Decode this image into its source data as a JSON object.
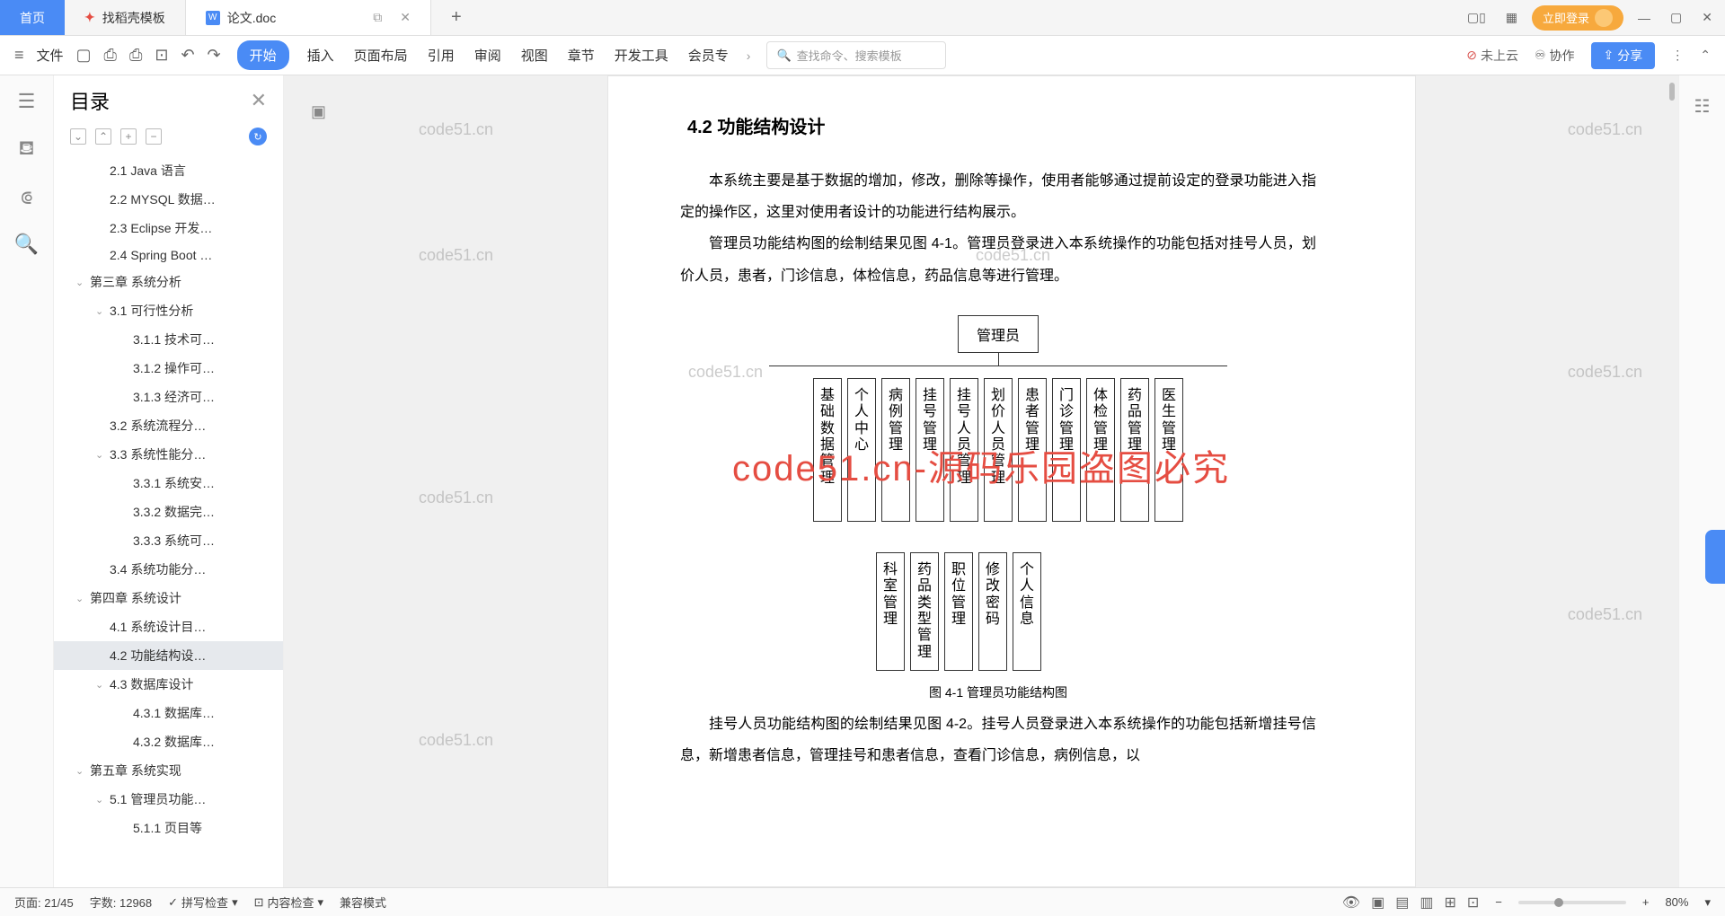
{
  "titlebar": {
    "home": "首页",
    "tab1": "找稻壳模板",
    "tab2": "论文.doc",
    "login": "立即登录"
  },
  "ribbon": {
    "file": "文件",
    "tabs": [
      "开始",
      "插入",
      "页面布局",
      "引用",
      "审阅",
      "视图",
      "章节",
      "开发工具",
      "会员专"
    ],
    "search_ph": "查找命令、搜索模板",
    "cloud": "未上云",
    "coop": "协作",
    "share": "分享"
  },
  "outline": {
    "title": "目录",
    "items": [
      {
        "lvl": 2,
        "t": "2.1 Java 语言"
      },
      {
        "lvl": 2,
        "t": "2.2 MYSQL 数据…"
      },
      {
        "lvl": 2,
        "t": "2.3 Eclipse 开发…"
      },
      {
        "lvl": 2,
        "t": "2.4 Spring Boot …"
      },
      {
        "lvl": 1,
        "chev": true,
        "t": "第三章  系统分析"
      },
      {
        "lvl": 2,
        "chev": true,
        "t": "3.1 可行性分析"
      },
      {
        "lvl": 3,
        "t": "3.1.1 技术可…"
      },
      {
        "lvl": 3,
        "t": "3.1.2 操作可…"
      },
      {
        "lvl": 3,
        "t": "3.1.3 经济可…"
      },
      {
        "lvl": 2,
        "t": "3.2 系统流程分…"
      },
      {
        "lvl": 2,
        "chev": true,
        "t": "3.3 系统性能分…"
      },
      {
        "lvl": 3,
        "t": "3.3.1 系统安…"
      },
      {
        "lvl": 3,
        "t": "3.3.2 数据完…"
      },
      {
        "lvl": 3,
        "t": "3.3.3 系统可…"
      },
      {
        "lvl": 2,
        "t": "3.4 系统功能分…"
      },
      {
        "lvl": 1,
        "chev": true,
        "t": "第四章  系统设计"
      },
      {
        "lvl": 2,
        "t": "4.1 系统设计目…"
      },
      {
        "lvl": 2,
        "t": "4.2 功能结构设…",
        "active": true
      },
      {
        "lvl": 2,
        "chev": true,
        "t": "4.3 数据库设计"
      },
      {
        "lvl": 3,
        "t": "4.3.1 数据库…"
      },
      {
        "lvl": 3,
        "t": "4.3.2 数据库…"
      },
      {
        "lvl": 1,
        "chev": true,
        "t": "第五章  系统实现"
      },
      {
        "lvl": 2,
        "chev": true,
        "t": "5.1 管理员功能…"
      },
      {
        "lvl": 3,
        "t": "5.1.1 页目等"
      }
    ]
  },
  "doc": {
    "heading": "4.2 功能结构设计",
    "para1": "本系统主要是基于数据的增加，修改，删除等操作，使用者能够通过提前设定的登录功能进入指定的操作区，这里对使用者设计的功能进行结构展示。",
    "para2": "管理员功能结构图的绘制结果见图 4-1。管理员登录进入本系统操作的功能包括对挂号人员，划价人员，患者，门诊信息，体检信息，药品信息等进行管理。",
    "org_root": "管理员",
    "leaves": [
      "基础数据管理",
      "个人中心",
      "病例管理",
      "挂号管理",
      "挂号人员管理",
      "划价人员管理",
      "患者管理",
      "门诊管理",
      "体检管理",
      "药品管理",
      "医生管理"
    ],
    "sub_leaves": [
      "科室管理",
      "药品类型管理",
      "职位管理",
      "修改密码",
      "个人信息"
    ],
    "fig_caption": "图 4-1  管理员功能结构图",
    "para3": "挂号人员功能结构图的绘制结果见图 4-2。挂号人员登录进入本系统操作的功能包括新增挂号信息，新增患者信息，管理挂号和患者信息，查看门诊信息，病例信息，以",
    "watermark": "code51.cn",
    "red_banner": "code51.cn-源码乐园盗图必究"
  },
  "status": {
    "page": "页面: 21/45",
    "words": "字数: 12968",
    "spell": "拼写检查",
    "content": "内容检查",
    "compat": "兼容模式",
    "zoom": "80%"
  }
}
